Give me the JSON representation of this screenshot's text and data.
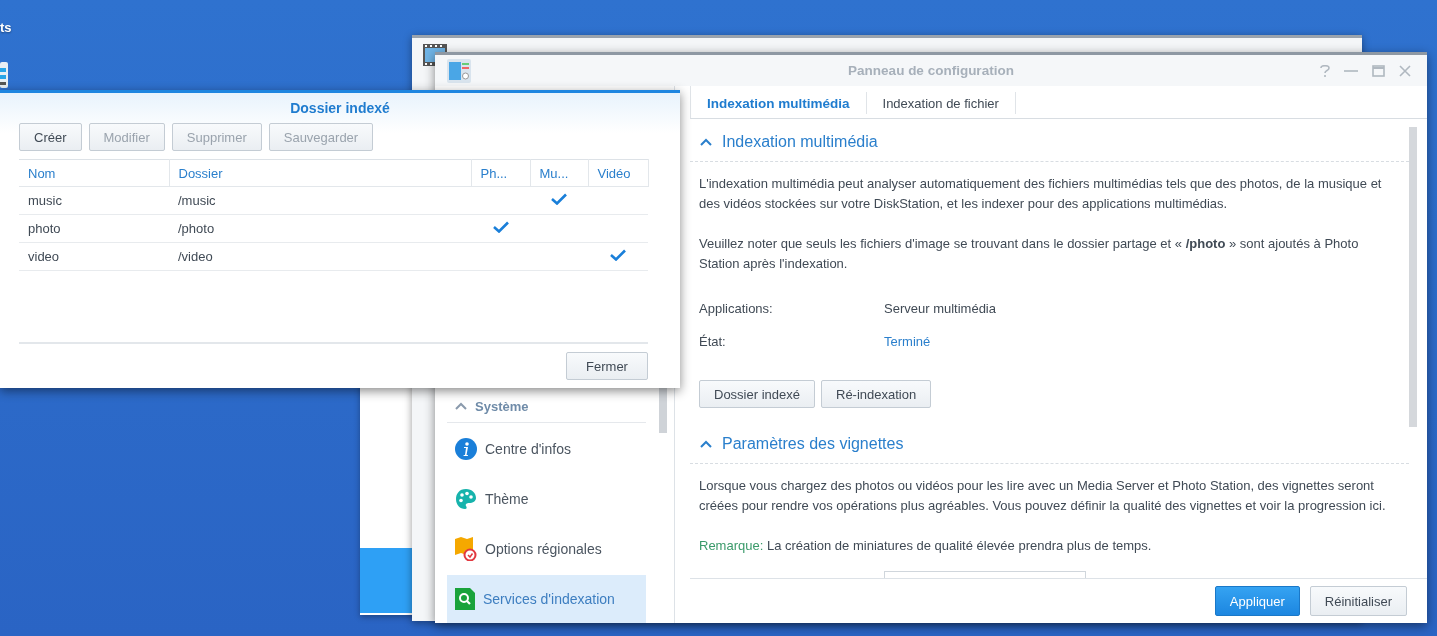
{
  "desktop": {
    "label": "ts"
  },
  "control_panel": {
    "title": "Panneau de configuration",
    "sidebar": {
      "group": "Système",
      "expanded": true,
      "items": [
        {
          "label": "Centre d'infos",
          "kind": "info",
          "selected": false
        },
        {
          "label": "Thème",
          "kind": "theme",
          "selected": false
        },
        {
          "label": "Options régionales",
          "kind": "region",
          "selected": false
        },
        {
          "label": "Services d'indexation",
          "kind": "indexing",
          "selected": true
        }
      ]
    },
    "tabs": [
      {
        "label": "Indexation multimédia",
        "selected": true
      },
      {
        "label": "Indexation de fichier",
        "selected": false
      }
    ],
    "media_section": {
      "title": "Indexation multimédia",
      "expanded": true,
      "paragraphs": [
        "L'indexation multimédia peut analyser automatiquement des fichiers multimédias tels que des photos, de la musique et des vidéos stockées sur votre DiskStation, et les indexer pour des applications multimédias.",
        "Veuillez noter que seuls les fichiers d'image se trouvant dans le dossier partage et « **/photo** » sont ajoutés à Photo Station après l'indexation."
      ],
      "fields": [
        {
          "label": "Applications:",
          "value": "Serveur multimédia",
          "kind": "text"
        },
        {
          "label": "État:",
          "value": "Terminé",
          "kind": "status"
        }
      ],
      "buttons": [
        "Dossier indexé",
        "Ré-indexation"
      ]
    },
    "thumb_section": {
      "title": "Paramètres des vignettes",
      "expanded": true,
      "paragraph": "Lorsque vous chargez des photos ou vidéos pour les lire avec un Media Server et Photo Station, des vignettes seront créées pour rendre vos opérations plus agréables. Vous pouvez définir la qualité des vignettes et voir la progression ici.",
      "note": {
        "label": "Remarque:",
        "text": "La création de miniatures de qualité élevée prendra plus de temps."
      }
    },
    "footer_buttons": [
      {
        "label": "Appliquer",
        "kind": "primary"
      },
      {
        "label": "Réinitialiser",
        "kind": "secondary"
      }
    ]
  },
  "dialog": {
    "title": "Dossier indexé",
    "toolbar": [
      {
        "label": "Créer",
        "disabled": false
      },
      {
        "label": "Modifier",
        "disabled": true
      },
      {
        "label": "Supprimer",
        "disabled": true
      },
      {
        "label": "Sauvegarder",
        "disabled": true
      }
    ],
    "columns": [
      "Nom",
      "Dossier",
      "Ph...",
      "Mu...",
      "Vidéo"
    ],
    "rows": [
      {
        "name": "music",
        "folder": "/music",
        "photo": false,
        "music": true,
        "video": false
      },
      {
        "name": "photo",
        "folder": "/photo",
        "photo": true,
        "music": false,
        "video": false
      },
      {
        "name": "video",
        "folder": "/video",
        "photo": false,
        "music": false,
        "video": true
      }
    ],
    "close_button": "Fermer"
  }
}
